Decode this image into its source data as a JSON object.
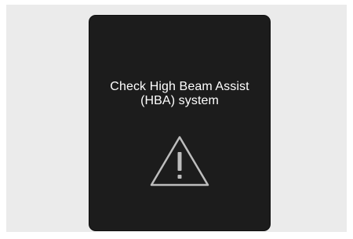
{
  "warning_display": {
    "message_line1": "Check High Beam Assist",
    "message_line2": "(HBA) system",
    "icon": "warning-triangle-icon",
    "background_color": "#1c1c1c",
    "text_color": "#ffffff",
    "icon_color": "#bdbdbd"
  }
}
